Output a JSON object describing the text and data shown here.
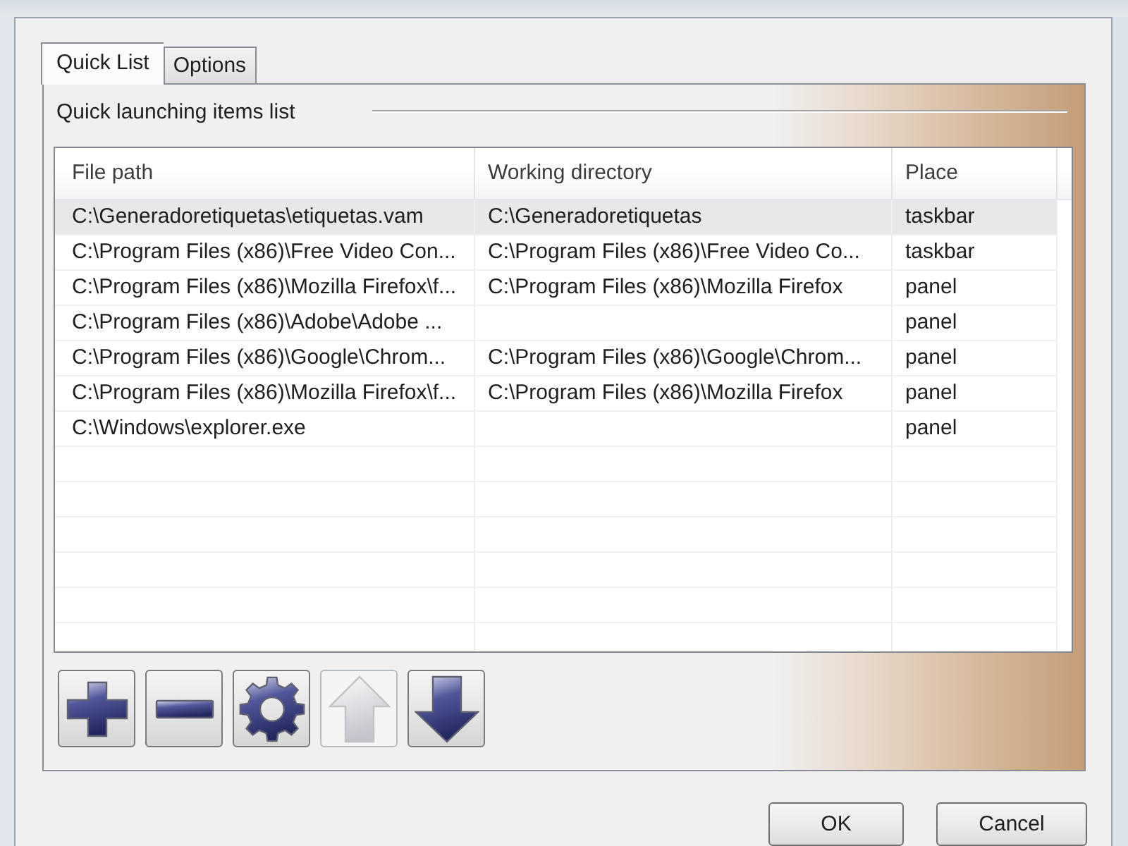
{
  "tabs": [
    {
      "label": "Quick List",
      "selected": true
    },
    {
      "label": "Options",
      "selected": false
    }
  ],
  "section": {
    "title": "Quick launching items list"
  },
  "table": {
    "columns": [
      "File path",
      "Working directory",
      "Place"
    ],
    "rows": [
      {
        "file_path": "C:\\Generadoretiquetas\\etiquetas.vam",
        "working_directory": "C:\\Generadoretiquetas",
        "place": "taskbar",
        "selected": true
      },
      {
        "file_path": "C:\\Program Files (x86)\\Free Video Con...",
        "working_directory": "C:\\Program Files (x86)\\Free Video Co...",
        "place": "taskbar",
        "selected": false
      },
      {
        "file_path": "C:\\Program Files (x86)\\Mozilla Firefox\\f...",
        "working_directory": "C:\\Program Files (x86)\\Mozilla Firefox",
        "place": "panel",
        "selected": false
      },
      {
        "file_path": "C:\\Program Files (x86)\\Adobe\\Adobe ...",
        "place": "panel",
        "selected": false
      },
      {
        "file_path": "C:\\Program Files (x86)\\Google\\Chrom...",
        "working_directory": "C:\\Program Files (x86)\\Google\\Chrom...",
        "place": "panel",
        "selected": false
      },
      {
        "file_path": "C:\\Program Files (x86)\\Mozilla Firefox\\f...",
        "working_directory": "C:\\Program Files (x86)\\Mozilla Firefox",
        "place": "panel",
        "selected": false
      },
      {
        "file_path": "C:\\Windows\\explorer.exe",
        "place": "panel",
        "selected": false
      }
    ]
  },
  "toolbar": [
    {
      "kind": "add",
      "disabled": false
    },
    {
      "kind": "remove",
      "disabled": false
    },
    {
      "kind": "settings",
      "disabled": false
    },
    {
      "kind": "up",
      "disabled": true
    },
    {
      "kind": "down",
      "disabled": false
    }
  ],
  "buttons": [
    "OK",
    "Cancel"
  ]
}
